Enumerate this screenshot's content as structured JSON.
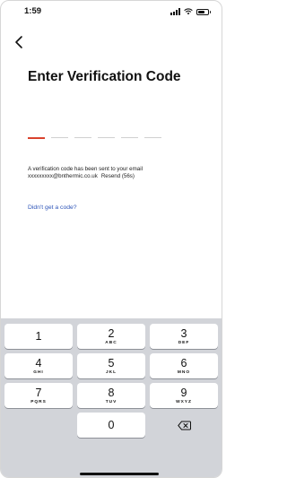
{
  "status": {
    "time": "1:59",
    "signal_icon": "signal-bars-icon",
    "wifi_icon": "wifi-icon",
    "battery_icon": "battery-icon"
  },
  "nav": {
    "back_icon": "chevron-left-icon"
  },
  "page": {
    "title": "Enter Verification Code",
    "code_slots": 6,
    "message_line1": "A verification code has been sent to your email",
    "email": "xxxxxxxxx@bnthermic.co.uk",
    "resend": "Resend (56s)",
    "help_link": "Didn't get a code?"
  },
  "colors": {
    "accent_active_slot": "#d9422e",
    "link": "#2d54b8",
    "keyboard_bg": "#d2d4d9"
  },
  "keypad": {
    "keys": [
      {
        "digit": "1",
        "letters": ""
      },
      {
        "digit": "2",
        "letters": "ABC"
      },
      {
        "digit": "3",
        "letters": "DEF"
      },
      {
        "digit": "4",
        "letters": "GHI"
      },
      {
        "digit": "5",
        "letters": "JKL"
      },
      {
        "digit": "6",
        "letters": "MNO"
      },
      {
        "digit": "7",
        "letters": "PQRS"
      },
      {
        "digit": "8",
        "letters": "TUV"
      },
      {
        "digit": "9",
        "letters": "WXYZ"
      },
      {
        "digit": "0",
        "letters": ""
      }
    ],
    "delete_icon": "backspace-icon"
  }
}
